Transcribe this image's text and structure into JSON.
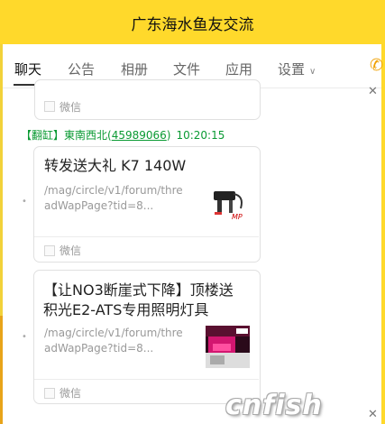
{
  "window": {
    "title": "广东海水鱼友交流"
  },
  "tabs": [
    {
      "label": "聊天",
      "active": true
    },
    {
      "label": "公告"
    },
    {
      "label": "相册"
    },
    {
      "label": "文件"
    },
    {
      "label": "应用"
    },
    {
      "label": "设置"
    }
  ],
  "messages": [
    {
      "source": "微信"
    },
    {
      "sender": {
        "name": "【翻缸】東南西北",
        "id_open": "(",
        "group_id": "45989066",
        "id_close": ")",
        "time": "10:20:15"
      },
      "card": {
        "title": "转发送大礼 K7 140W",
        "url": "/mag/circle/v1/forum/threadWapPage?tid=8...",
        "url_line1": "/mag/circle/v1/forum/thre",
        "url_line2": "adWapPage?tid=8...",
        "source": "微信"
      }
    },
    {
      "card": {
        "title": "【让NO3断崖式下降】顶楼送积光E2-ATS专用照明灯具",
        "title_line1": "【让NO3断崖式下降】顶楼送",
        "title_line2": "积光E2-ATS专用照明灯具",
        "url": "/mag/circle/v1/forum/threadWapPage?tid=8...",
        "url_line1": "/mag/circle/v1/forum/thre",
        "url_line2": "adWapPage?tid=8...",
        "source": "微信"
      }
    }
  ],
  "watermark": "cnfish",
  "colors": {
    "titlebar": "#ffd92b",
    "sender": "#0a9a33",
    "phone": "#f0a000"
  },
  "icons": {
    "phone": "phone-icon",
    "close": "close-icon",
    "chevron": "chevron-down-icon",
    "checkbox": "checkbox-icon"
  }
}
